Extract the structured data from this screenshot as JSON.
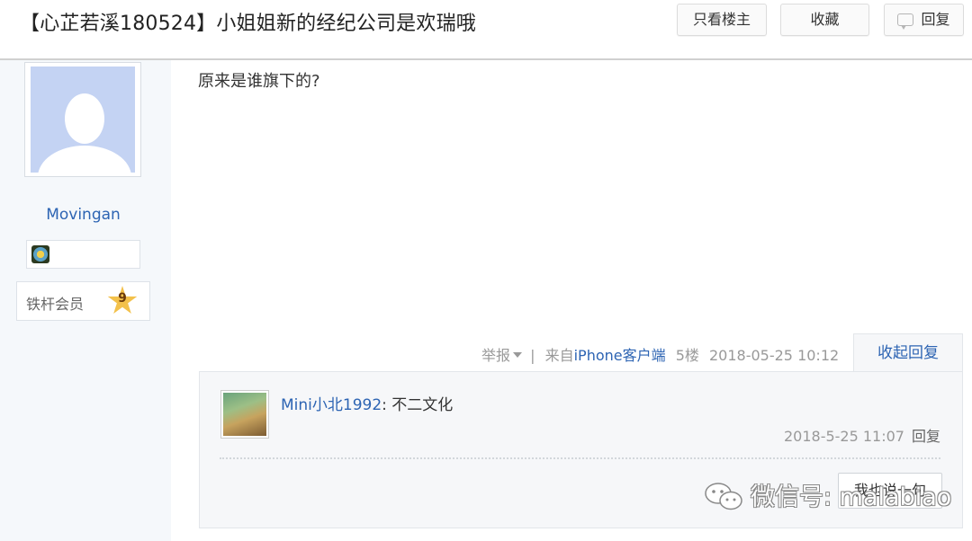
{
  "header": {
    "title": "【心芷若溪180524】小姐姐新的经纪公司是欢瑞哦",
    "buttons": {
      "only_op": "只看楼主",
      "favorite": "收藏",
      "reply": "回复"
    }
  },
  "author": {
    "username": "Movingan",
    "member_title": "铁杆会员",
    "level": "9"
  },
  "post": {
    "content": "原来是谁旗下的?",
    "report": "举报",
    "separator": "|",
    "source_prefix": "来自",
    "source_client": "iPhone客户端",
    "floor": "5楼",
    "datetime": "2018-05-25 10:12",
    "collapse_replies": "收起回复"
  },
  "replies": [
    {
      "username": "Mini小北1992",
      "colon": ":",
      "content": "不二文化",
      "datetime": "2018-5-25 11:07",
      "reply_label": "回复"
    }
  ],
  "say_button": "我也说一句",
  "watermark": {
    "text": "微信号: malabiao"
  },
  "colors": {
    "link": "#2d64b3",
    "sidebar_bg": "#f5f8fb",
    "reply_box_bg": "#f6f7f9",
    "meta_text": "#999999"
  }
}
